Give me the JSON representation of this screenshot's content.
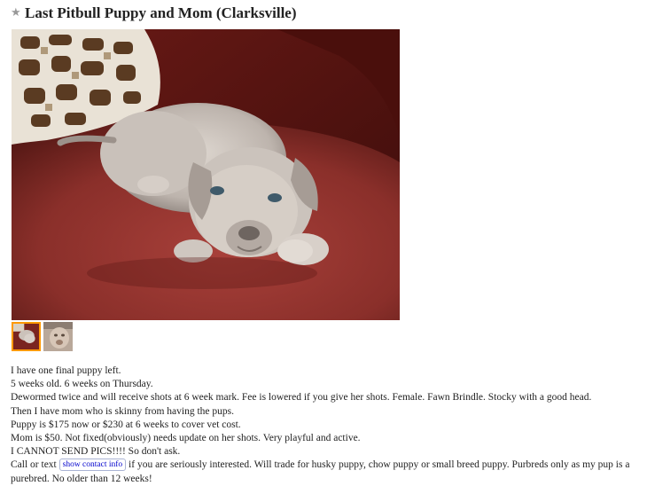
{
  "posting": {
    "title": "Last Pitbull Puppy and Mom (Clarksville)",
    "favorite_icon": "star-icon",
    "images": {
      "main_alt": "puppy-photo",
      "thumbnails": [
        "puppy-thumbnail",
        "mom-dog-thumbnail"
      ],
      "selected_index": 0
    },
    "body": {
      "lines": [
        "I have one final puppy left.",
        "5 weeks old. 6 weeks on Thursday.",
        "Dewormed twice and will receive shots at 6 week mark. Fee is lowered if you give her shots. Female. Fawn Brindle. Stocky with a good head.",
        "Then I have mom who is skinny from having the pups.",
        "Puppy is $175 now or $230 at 6 weeks to cover vet cost.",
        "Mom is $50. Not fixed(obviously) needs update on her shots. Very playful and active.",
        "I CANNOT SEND PICS!!!! So don't ask."
      ],
      "contact_prefix": "Call or text",
      "contact_button": "show contact info",
      "contact_suffix": "if you are seriously interested. Will trade for husky puppy, chow puppy or small breed puppy. Purbreds only as my pup is a purebred. No older than 12 weeks!"
    }
  },
  "colors": {
    "selected_thumb_border": "#ff9900",
    "link": "#0000cc",
    "star": "#999999"
  }
}
